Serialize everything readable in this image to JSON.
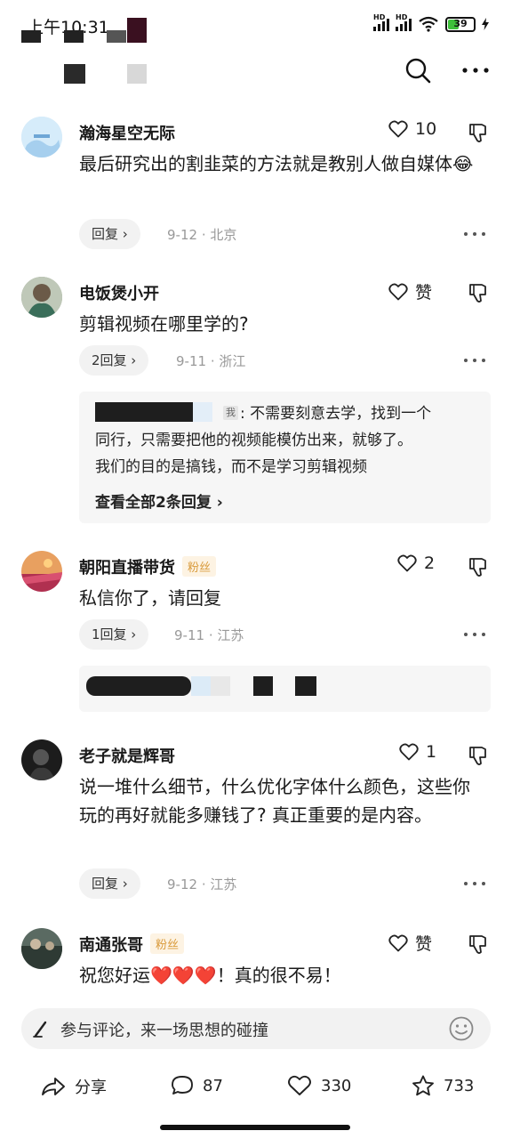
{
  "status_bar": {
    "time": "上午10:31",
    "battery": "39"
  },
  "comments": [
    {
      "name": "瀚海星空无际",
      "badge": "",
      "likes": "10",
      "text": "最后研究出的割韭菜的方法就是教别人做自媒体😂",
      "reply_label": "回复 ›",
      "date": "9-12",
      "location": "北京"
    },
    {
      "name": "电饭煲小开",
      "badge": "",
      "likes": "赞",
      "text": "剪辑视频在哪里学的?",
      "reply_label": "2回复 ›",
      "date": "9-11",
      "location": "浙江",
      "reply_box": {
        "me_tag": "我",
        "line1": ": 不需要刻意去学，找到一个",
        "line2": "同行，只需要把他的视频能模仿出来，就够了。",
        "line3": "我们的目的是搞钱，而不是学习剪辑视频",
        "view_all": "查看全部2条回复 ›"
      }
    },
    {
      "name": "朝阳直播带货",
      "badge": "粉丝",
      "likes": "2",
      "text": "私信你了，请回复",
      "reply_label": "1回复 ›",
      "date": "9-11",
      "location": "江苏"
    },
    {
      "name": "老子就是辉哥",
      "badge": "",
      "likes": "1",
      "text": "说一堆什么细节，什么优化字体什么颜色，这些你玩的再好就能多赚钱了? 真正重要的是内容。",
      "reply_label": "回复 ›",
      "date": "9-12",
      "location": "江苏"
    },
    {
      "name": "南通张哥",
      "badge": "粉丝",
      "likes": "赞",
      "text": "祝您好运❤️❤️❤️！真的很不易！"
    }
  ],
  "input": {
    "placeholder": "参与评论，来一场思想的碰撞"
  },
  "actions": {
    "share": "分享",
    "comments": "87",
    "likes": "330",
    "favorites": "733"
  },
  "colors": {
    "badge_text": "#d99a3a",
    "badge_bg": "#fdf3e3",
    "battery_fill": "#3ec03a"
  }
}
